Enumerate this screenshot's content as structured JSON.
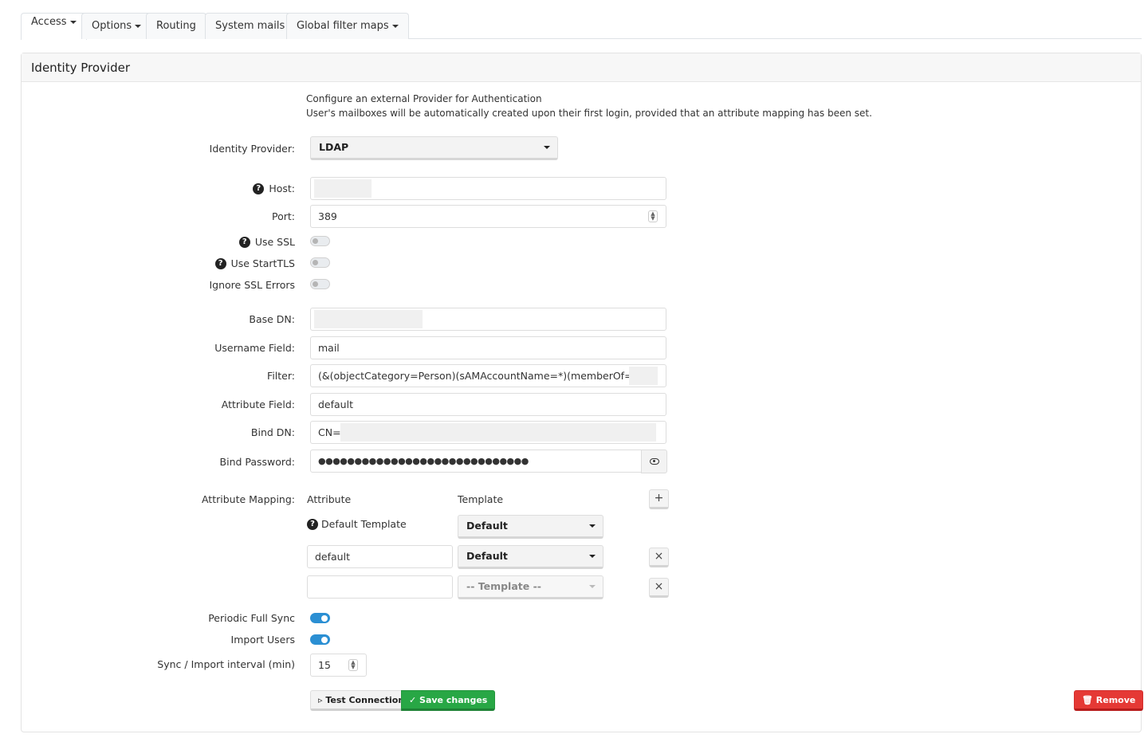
{
  "tabs": [
    {
      "label": "Access",
      "dropdown": true,
      "active": true
    },
    {
      "label": "Options",
      "dropdown": true
    },
    {
      "label": "Routing",
      "dropdown": false
    },
    {
      "label": "System mails",
      "dropdown": false
    },
    {
      "label": "Global filter maps",
      "dropdown": true
    }
  ],
  "panel": {
    "title": "Identity Provider",
    "desc_line1": "Configure an external Provider for Authentication",
    "desc_line2": "User's mailboxes will be automatically created upon their first login, provided that an attribute mapping has been set."
  },
  "form": {
    "idp_label": "Identity Provider:",
    "idp_value": "LDAP",
    "host_label": "Host:",
    "port_label": "Port:",
    "port_value": "389",
    "use_ssl_label": "Use SSL",
    "use_starttls_label": "Use StartTLS",
    "ignore_ssl_label": "Ignore SSL Errors",
    "base_dn_label": "Base DN:",
    "username_field_label": "Username Field:",
    "username_field_value": "mail",
    "filter_label": "Filter:",
    "filter_value": "(&(objectCategory=Person)(sAMAccountName=*)(memberOf=CN=",
    "attribute_field_label": "Attribute Field:",
    "attribute_field_value": "default",
    "bind_dn_label": "Bind DN:",
    "bind_dn_value": "CN=I",
    "bind_password_label": "Bind Password:",
    "bind_password_value": "●●●●●●●●●●●●●●●●●●●●●●●●●●●●●"
  },
  "mapping": {
    "label": "Attribute Mapping:",
    "col_attribute": "Attribute",
    "col_template": "Template",
    "add_symbol": "+",
    "default_template_label": "Default Template",
    "default_template_value": "Default",
    "row1_attribute": "default",
    "row1_template": "Default",
    "row2_attribute": "",
    "row2_template_placeholder": "-- Template --",
    "remove_symbol": "×"
  },
  "sync": {
    "periodic_label": "Periodic Full Sync",
    "import_label": "Import Users",
    "interval_label": "Sync / Import interval (min)",
    "interval_value": "15"
  },
  "buttons": {
    "test": "▹ Test Connection",
    "save": "✓ Save changes",
    "remove": "🗑 Remove"
  },
  "colors": {
    "toggle_on": "#2b8fd3",
    "save": "#28a745",
    "remove": "#e53935"
  }
}
